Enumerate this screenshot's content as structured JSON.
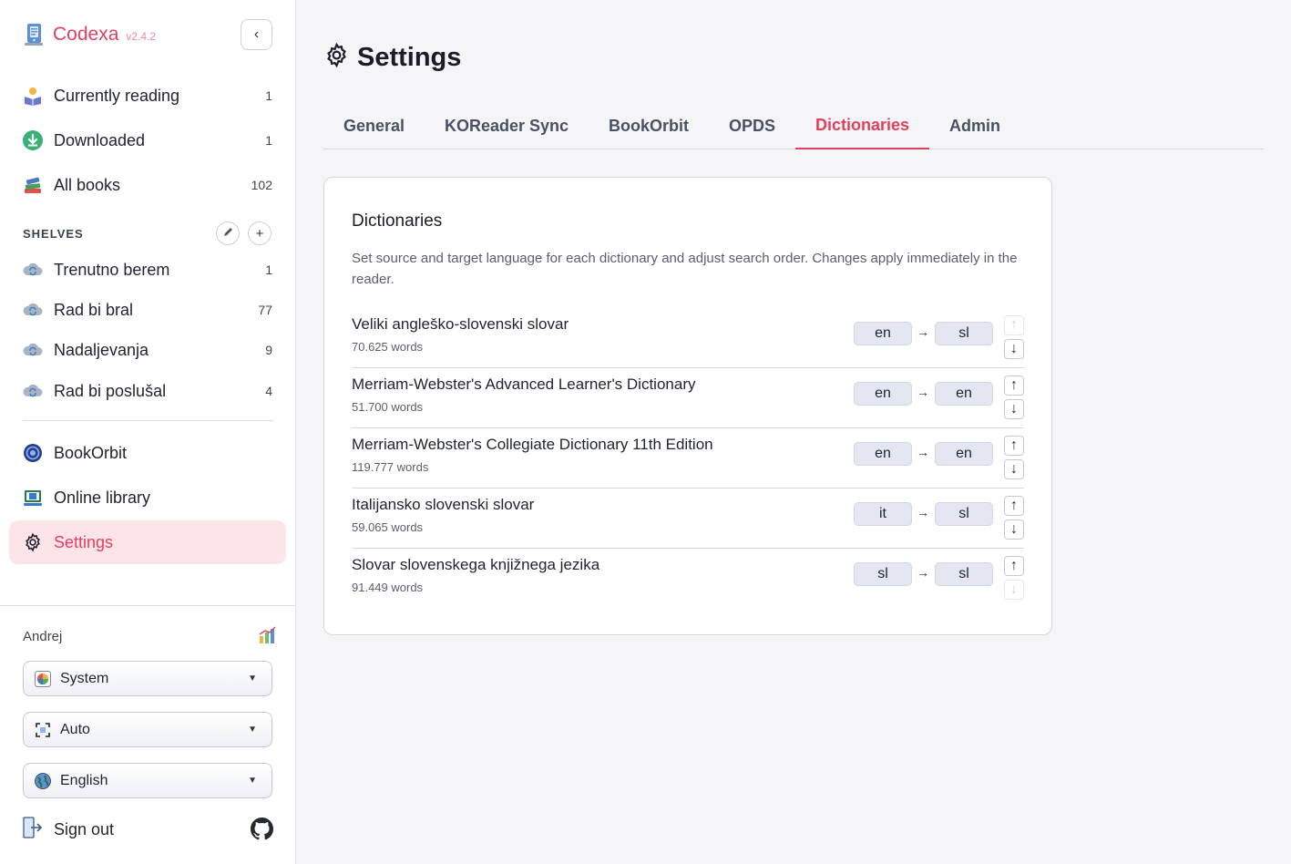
{
  "brand": {
    "name": "Codexa",
    "version": "v2.4.2"
  },
  "sidebar": {
    "collapse_icon": "‹",
    "library": [
      {
        "label": "Currently reading",
        "count": "1",
        "icon": "reading-icon"
      },
      {
        "label": "Downloaded",
        "count": "1",
        "icon": "download-icon"
      },
      {
        "label": "All books",
        "count": "102",
        "icon": "books-icon"
      }
    ],
    "shelves_header": "SHELVES",
    "shelves": [
      {
        "label": "Trenutno berem",
        "count": "1"
      },
      {
        "label": "Rad bi bral",
        "count": "77"
      },
      {
        "label": "Nadaljevanja",
        "count": "9"
      },
      {
        "label": "Rad bi poslušal",
        "count": "4"
      }
    ],
    "extra": [
      {
        "label": "BookOrbit",
        "icon": "bookorbit-icon"
      },
      {
        "label": "Online library",
        "icon": "online-library-icon"
      },
      {
        "label": "Settings",
        "icon": "gear-icon",
        "active": true
      }
    ],
    "user": "Andrej",
    "selects": [
      {
        "label": "System",
        "icon": "theme-icon"
      },
      {
        "label": "Auto",
        "icon": "fullscreen-icon"
      },
      {
        "label": "English",
        "icon": "globe-icon"
      }
    ],
    "sign_out": "Sign out"
  },
  "page": {
    "title": "Settings"
  },
  "tabs": [
    {
      "label": "General"
    },
    {
      "label": "KOReader Sync"
    },
    {
      "label": "BookOrbit"
    },
    {
      "label": "OPDS"
    },
    {
      "label": "Dictionaries",
      "active": true
    },
    {
      "label": "Admin"
    }
  ],
  "dictionaries": {
    "title": "Dictionaries",
    "description": "Set source and target language for each dictionary and adjust search order. Changes apply immediately in the reader.",
    "arrow": "→",
    "up": "↑",
    "down": "↓",
    "items": [
      {
        "name": "Veliki angleško-slovenski slovar",
        "words": "70.625 words",
        "source": "en",
        "target": "sl"
      },
      {
        "name": "Merriam-Webster's Advanced Learner's Dictionary",
        "words": "51.700 words",
        "source": "en",
        "target": "en"
      },
      {
        "name": "Merriam-Webster's Collegiate Dictionary 11th Edition",
        "words": "119.777 words",
        "source": "en",
        "target": "en"
      },
      {
        "name": "Italijansko slovenski slovar",
        "words": "59.065 words",
        "source": "it",
        "target": "sl"
      },
      {
        "name": "Slovar slovenskega knjižnega jezika",
        "words": "91.449 words",
        "source": "sl",
        "target": "sl"
      }
    ]
  },
  "colors": {
    "accent": "#e0405f",
    "active_bg": "#fde4e9"
  }
}
